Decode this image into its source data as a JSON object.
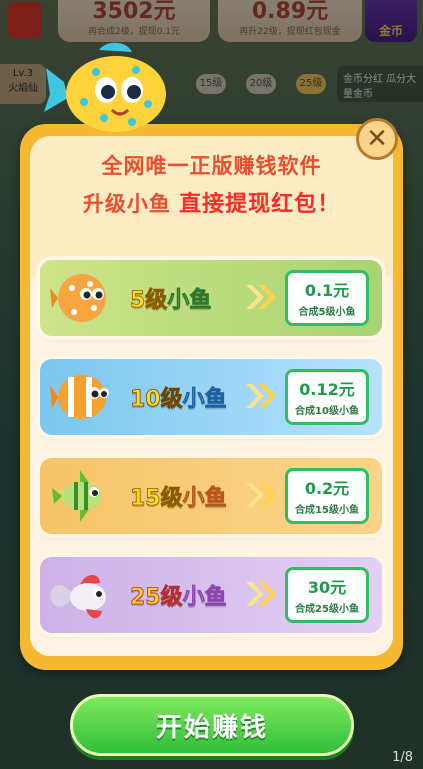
{
  "hud": {
    "cash_value": "3502元",
    "cash_sub": "再合成2级，提现0.1元",
    "balance_value": "0.89元",
    "balance_sub": "再升22级，提现红包现金",
    "coin_label": "金币",
    "level": "Lv.3",
    "level_name": "火焰仙",
    "progress_levels": [
      "15级",
      "20级",
      "25级"
    ],
    "promo_text": "金币分红 瓜分大量金币"
  },
  "modal": {
    "headline_line1": "全网唯一正版赚钱软件",
    "headline_line2_plain": "升级小鱼",
    "headline_line2_strong": "直接提现红包！",
    "close_symbol": "✕",
    "rows": [
      {
        "level": "5级",
        "fish": "小鱼",
        "amount": "0.1元",
        "desc": "合成5级小鱼"
      },
      {
        "level": "10级",
        "fish": "小鱼",
        "amount": "0.12元",
        "desc": "合成10级小鱼"
      },
      {
        "level": "15级",
        "fish": "小鱼",
        "amount": "0.2元",
        "desc": "合成15级小鱼"
      },
      {
        "level": "25级",
        "fish": "小鱼",
        "amount": "30元",
        "desc": "合成25级小鱼"
      }
    ]
  },
  "cta": {
    "label": "开始赚钱"
  },
  "page_indicator": "1/8",
  "colors": {
    "modal_border": "#f6b731",
    "cta_green": "#2fbf3a",
    "headline_red": "#ea4e2f"
  }
}
